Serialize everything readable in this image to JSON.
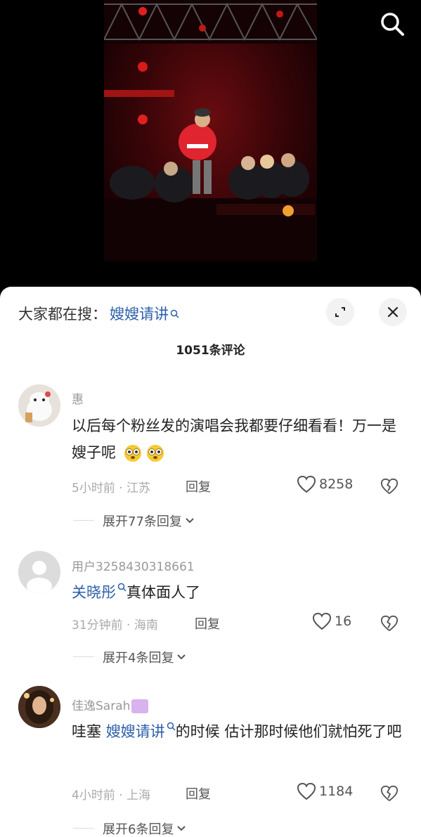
{
  "header": {
    "search_label": "大家都在搜：",
    "search_keyword": "嫂嫂请讲"
  },
  "comments_title": "1051条评论",
  "comments": [
    {
      "username": "惠",
      "text_plain": "以后每个粉丝发的演唱会我都要仔细看看！万一是嫂子呢",
      "time_location": "5小时前 · 江苏",
      "reply_label": "回复",
      "likes": "8258",
      "expand_label": "展开77条回复"
    },
    {
      "username": "用户3258430318661",
      "text_link": "关晓彤",
      "text_plain": "真体面人了",
      "time_location": "31分钟前 · 海南",
      "reply_label": "回复",
      "likes": "16",
      "expand_label": "展开4条回复"
    },
    {
      "username": "佳逸Sarah",
      "text_prefix": "哇塞 ",
      "text_link": "嫂嫂请讲",
      "text_plain": "的时候 估计那时候他们就怕死了吧",
      "time_location": "4小时前 · 上海",
      "reply_label": "回复",
      "likes": "1184",
      "expand_label": "展开6条回复"
    }
  ],
  "colors": {
    "link": "#2b5fa8",
    "muted": "#999999",
    "sheet_bg": "#ffffff"
  },
  "icons": [
    "search-icon",
    "expand-icon",
    "close-icon",
    "heart-icon",
    "broken-heart-icon",
    "chevron-down-icon"
  ]
}
